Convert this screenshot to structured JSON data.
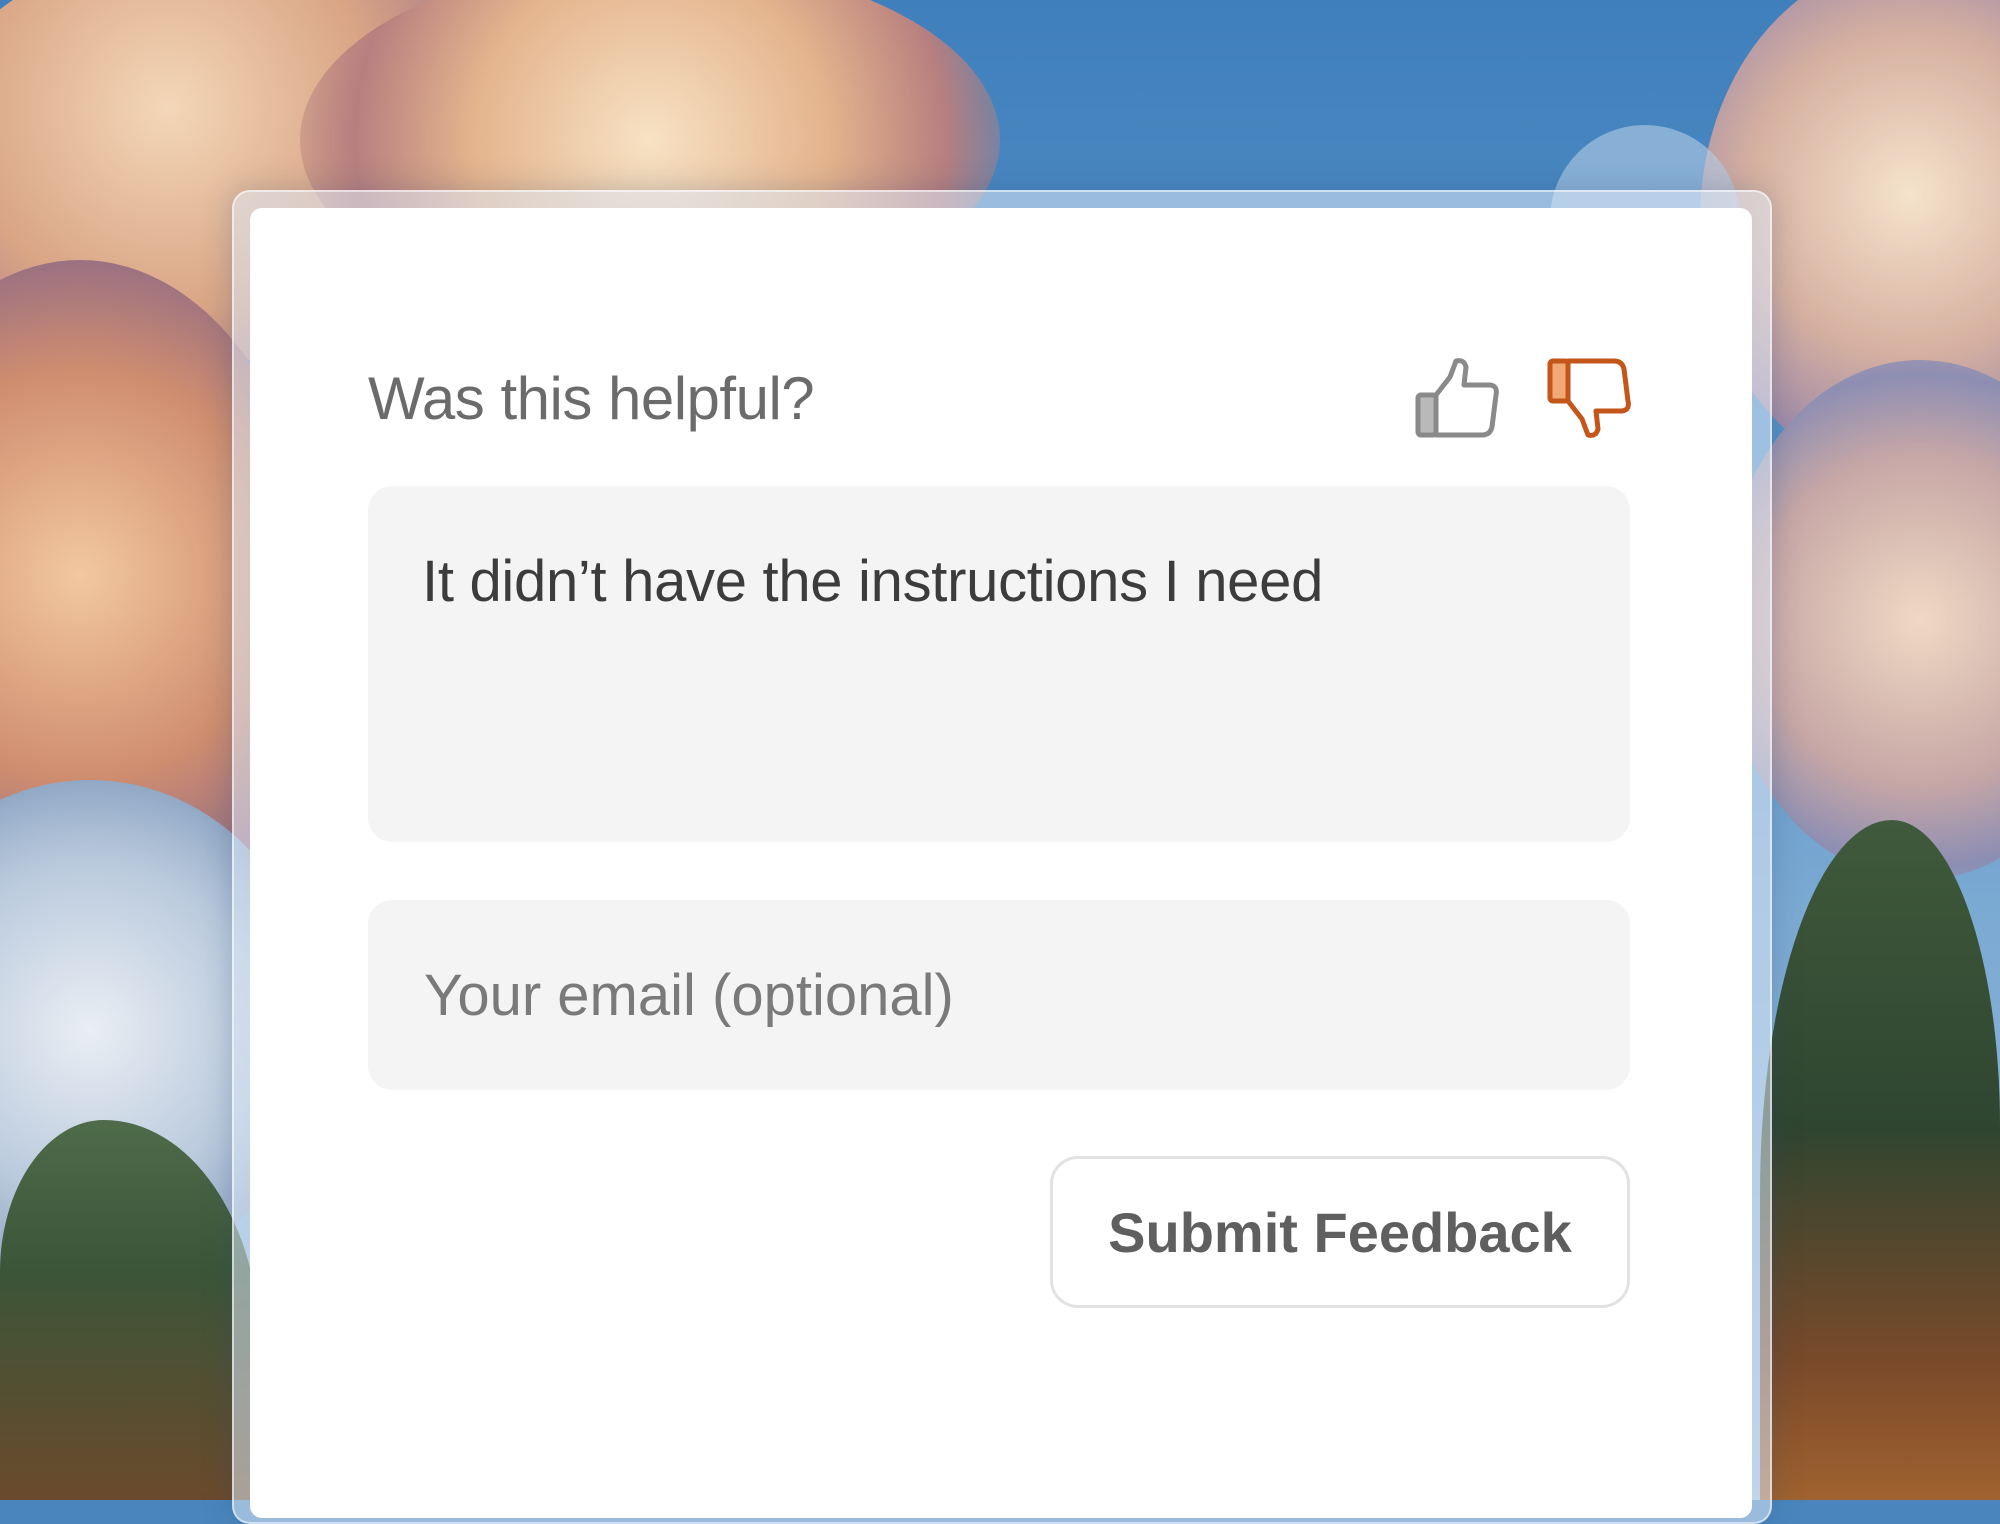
{
  "feedback": {
    "question": "Was this helpful?",
    "thumbs_up_icon": "thumbs-up-icon",
    "thumbs_down_icon": "thumbs-down-icon",
    "thumbs_down_selected": true,
    "comment_value": "It didn’t have the instructions I need",
    "email_value": "",
    "email_placeholder": "Your email (optional)",
    "submit_label": "Submit Feedback"
  },
  "colors": {
    "thumbs_up": "#8a8a8a",
    "thumbs_down_selected": "#c4561a",
    "card": "#ffffff",
    "input_bg": "#f4f4f5"
  }
}
